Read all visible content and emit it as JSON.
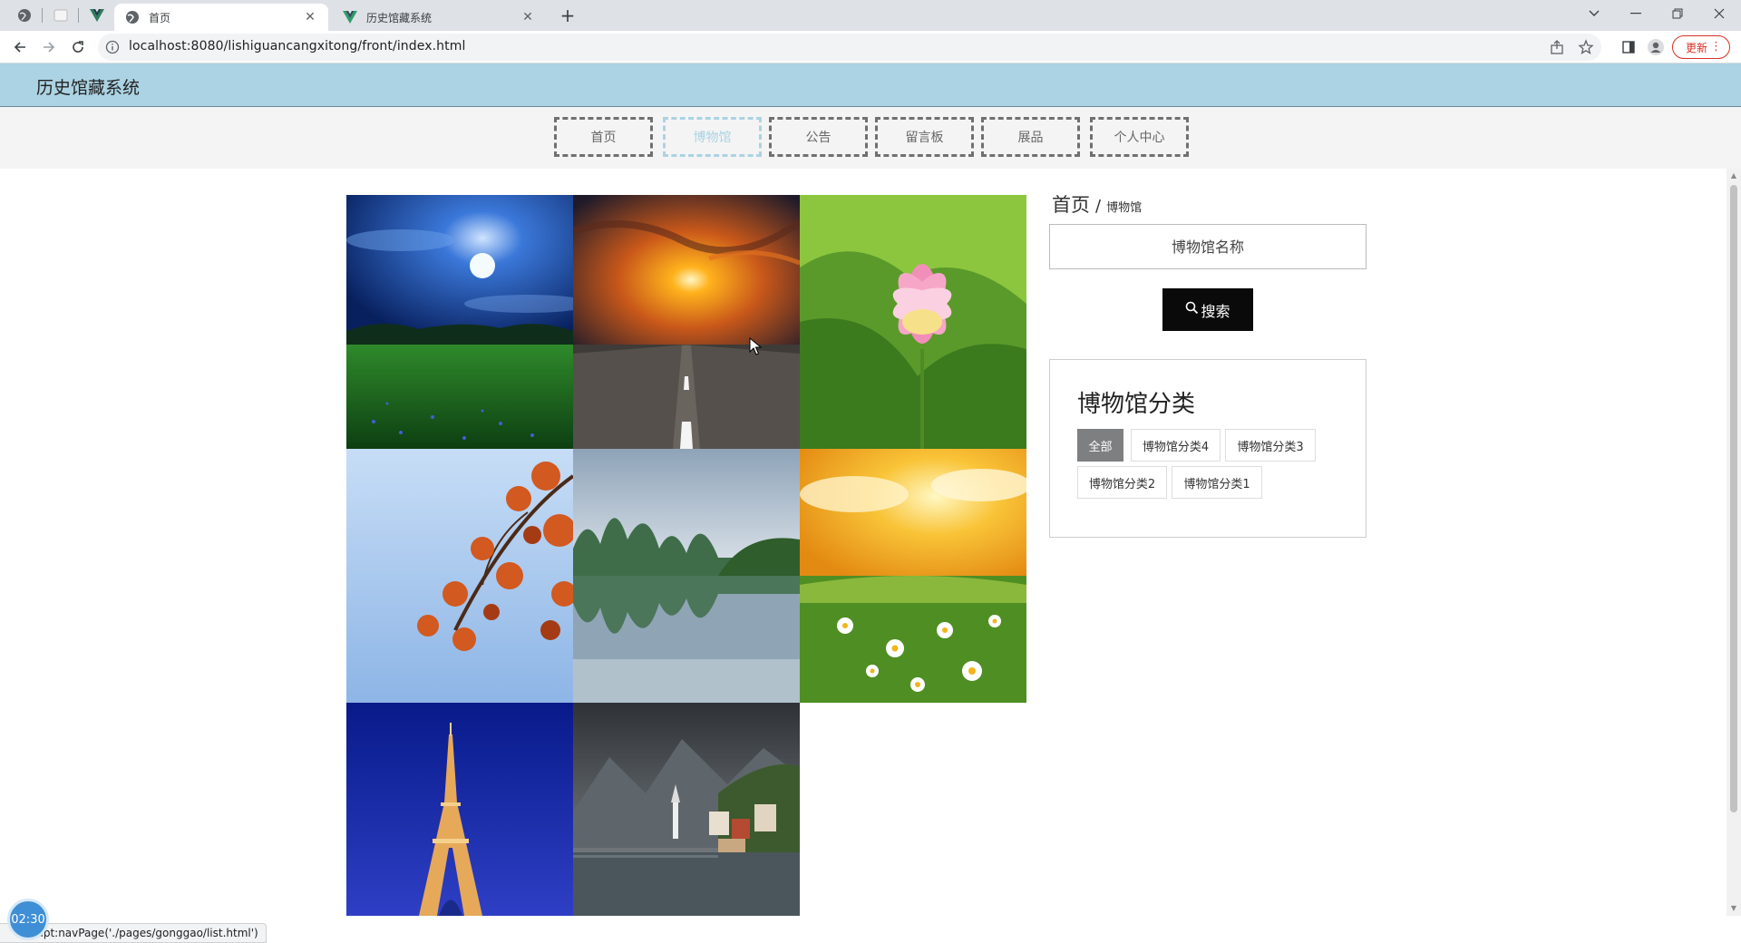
{
  "browser": {
    "tabs": [
      {
        "title": "首页",
        "icon": "globe-icon",
        "active": true
      },
      {
        "title": "历史馆藏系统",
        "icon": "vue-logo-icon",
        "active": false
      }
    ],
    "url": "localhost:8080/lishiguancangxitong/front/index.html",
    "update_label": "更新",
    "status_text": "ja        ipt:navPage('./pages/gonggao/list.html')"
  },
  "site": {
    "title": "历史馆藏系统",
    "nav": [
      {
        "label": "首页",
        "active": false
      },
      {
        "label": "博物馆",
        "active": true
      },
      {
        "label": "公告",
        "active": false
      },
      {
        "label": "留言板",
        "active": false
      },
      {
        "label": "展品",
        "active": false
      },
      {
        "label": "个人中心",
        "active": false
      }
    ]
  },
  "breadcrumb": {
    "home": "首页",
    "separator": "/",
    "current": "博物馆"
  },
  "search": {
    "placeholder": "博物馆名称",
    "button_label": "搜索"
  },
  "categories": {
    "title": "博物馆分类",
    "items": [
      {
        "label": "全部",
        "active": true
      },
      {
        "label": "博物馆分类4",
        "active": false
      },
      {
        "label": "博物馆分类3",
        "active": false
      },
      {
        "label": "博物馆分类2",
        "active": false
      },
      {
        "label": "博物馆分类1",
        "active": false
      }
    ]
  },
  "gallery": [
    {
      "name": "moonlit-meadow"
    },
    {
      "name": "sunset-road"
    },
    {
      "name": "pink-lotus"
    },
    {
      "name": "autumn-leaves"
    },
    {
      "name": "karst-river"
    },
    {
      "name": "daisy-field"
    },
    {
      "name": "eiffel-tower"
    },
    {
      "name": "lakeside-village"
    }
  ],
  "timer": "02:30",
  "colors": {
    "header": "#abd3e3",
    "active_nav": "#abd3e3",
    "search_button": "#0a0a0a",
    "active_category": "#7d7f81"
  }
}
